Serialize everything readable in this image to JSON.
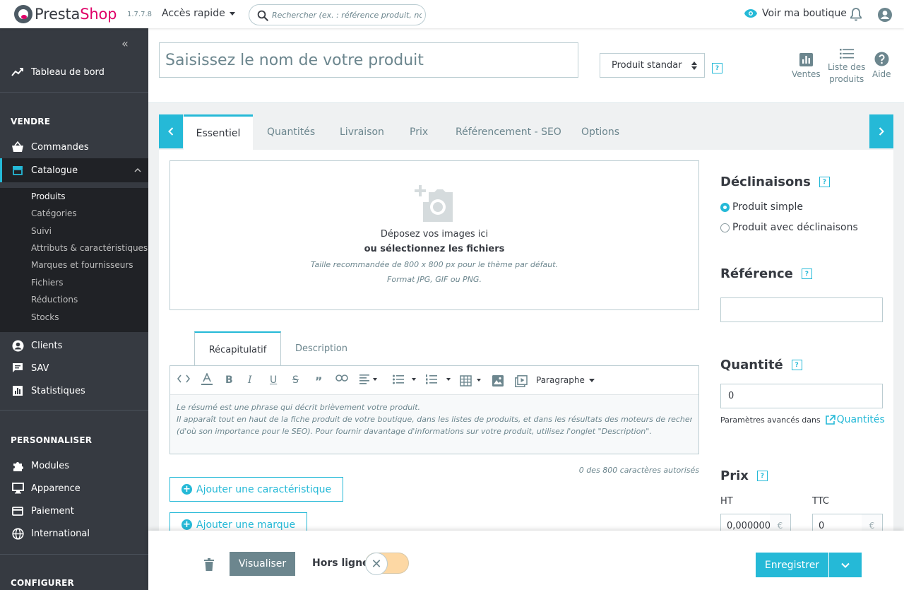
{
  "header": {
    "logo_part1": "Presta",
    "logo_part2": "Shop",
    "version": "1.7.7.8",
    "quick_access": "Accès rapide",
    "search_placeholder": "Rechercher (ex. : référence produit, nom",
    "view_shop": "Voir ma boutique"
  },
  "sidebar": {
    "dashboard": "Tableau de bord",
    "section_sell": "VENDRE",
    "orders": "Commandes",
    "catalog": "Catalogue",
    "catalog_sub": [
      "Produits",
      "Catégories",
      "Suivi",
      "Attributs & caractéristiques",
      "Marques et fournisseurs",
      "Fichiers",
      "Réductions",
      "Stocks"
    ],
    "customers": "Clients",
    "sav": "SAV",
    "stats": "Statistiques",
    "section_customize": "PERSONNALISER",
    "modules": "Modules",
    "appearance": "Apparence",
    "payment": "Paiement",
    "international": "International",
    "section_configure": "CONFIGURER"
  },
  "titlebar": {
    "name_placeholder": "Saisissez le nom de votre produit",
    "product_type": "Produit standar",
    "help_glyph": "?",
    "tool_sales": "Ventes",
    "tool_list_line1": "Liste des",
    "tool_list_line2": "produits",
    "tool_help": "Aide"
  },
  "tabs": [
    "Essentiel",
    "Quantités",
    "Livraison",
    "Prix",
    "Référencement - SEO",
    "Options"
  ],
  "dropzone": {
    "line1": "Déposez vos images ici",
    "line2": "ou sélectionnez les fichiers",
    "line3": "Taille recommandée de 800 x 800 px pour le thème par défaut.",
    "line4": "Format JPG, GIF ou PNG."
  },
  "editor": {
    "tab_summary": "Récapitulatif",
    "tab_description": "Description",
    "paragraph": "Paragraphe",
    "body_line1": "Le résumé est une phrase qui décrit brièvement votre produit.",
    "body_line2": "Il apparaît tout en haut de la fiche produit de votre boutique, dans les listes de produits, et dans les résultats des moteurs de recherche",
    "body_line3": "(d'où son importance pour le SEO). Pour fournir davantage d'informations sur votre produit, utilisez l'onglet \"Description\".",
    "char_count": "0 des 800 caractères autorisés"
  },
  "actions": {
    "add_feature": "Ajouter une caractéristique",
    "add_brand": "Ajouter une marque"
  },
  "right": {
    "variations_title": "Déclinaisons",
    "simple_product": "Produit simple",
    "with_variations": "Produit avec déclinaisons",
    "reference_title": "Référence",
    "reference_value": "",
    "quantity_title": "Quantité",
    "quantity_value": "0",
    "advanced_text": "Paramètres avancés dans",
    "advanced_link": "Quantités",
    "price_title": "Prix",
    "ht_label": "HT",
    "ttc_label": "TTC",
    "ht_value": "0,000000",
    "ttc_value": "0",
    "currency": "€"
  },
  "footer": {
    "preview": "Visualiser",
    "offline": "Hors ligne",
    "save": "Enregistrer"
  },
  "colors": {
    "accent": "#25b9d7",
    "brand_pink": "#df0067",
    "sidebar_bg": "#363a41",
    "secondary_button": "#6c868e",
    "toggle_off": "#fdd8a4"
  }
}
